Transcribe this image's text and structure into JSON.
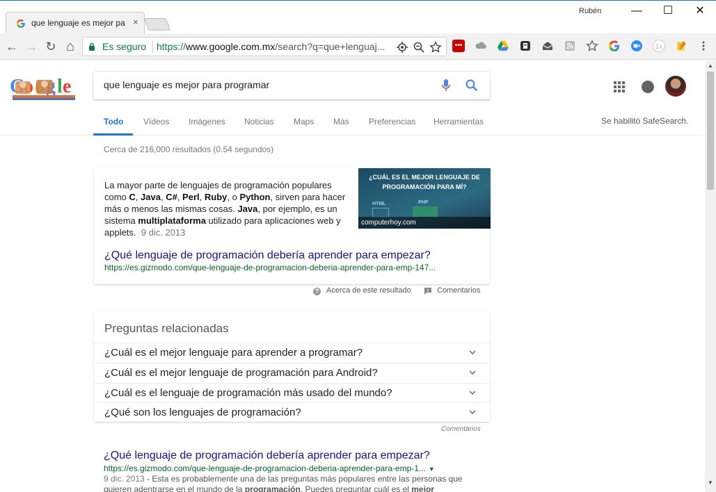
{
  "window": {
    "user_name": "Rubén",
    "minimize": "—",
    "maximize": "☐",
    "close": "✕"
  },
  "tab": {
    "title": "que lenguaje es mejor pa",
    "close": "×"
  },
  "toolbar": {
    "back": "←",
    "forward": "→",
    "reload": "↻",
    "home": "⌂",
    "secure_label": "Es seguro",
    "url_scheme": "https://",
    "url_host": "www.google.com.mx",
    "url_path": "/search?q=que+lenguaj...",
    "extensions": [
      "lastpass-icon",
      "cloud-icon",
      "drive-icon",
      "evernote-icon",
      "mail-icon",
      "rss-icon",
      "star-icon",
      "google-icon",
      "zoom-icon",
      "1x-icon",
      "notes-icon",
      "menu-icon"
    ],
    "ext_1x_label": "1x"
  },
  "google": {
    "search_query": "que lenguaje es mejor para programar",
    "tabs": [
      "Todo",
      "Vídeos",
      "Imágenes",
      "Noticias",
      "Maps",
      "Más",
      "Preferencias",
      "Herramientas"
    ],
    "safesearch": "Se habilitó SafeSearch."
  },
  "results": {
    "stats": "Cerca de 216,000 resultados (0.54 segundos)",
    "featured": {
      "text_parts": {
        "p1": "La mayor parte de lenguajes de programación populares como ",
        "c": "C",
        "comma1": ", ",
        "java": "Java",
        "comma2": ", ",
        "csharp": "C#",
        "comma3": ", ",
        "perl": "Perl",
        "comma4": ", ",
        "ruby": "Ruby",
        "o": ", o ",
        "python": "Python",
        "p2": ", sirven para hacer más o menos las mismas cosas. ",
        "java2": "Java",
        "p3": ", por ejemplo, es un sistema ",
        "multi": "multiplataforma",
        "p4": " utilizado para aplicaciones web y applets.",
        "date": "9 dic. 2013"
      },
      "image_title": "¿CUÁL ES EL MEJOR LENGUAJE DE PROGRAMACIÓN PARA MÍ?",
      "image_source": "computerhoy.com",
      "image_labels": [
        "HTML",
        "PHP"
      ],
      "link_title": "¿Qué lenguaje de programación debería aprender para empezar?",
      "link_url": "https://es.gizmodo.com/que-lenguaje-de-programacion-deberia-aprender-para-emp-147..."
    },
    "about_label": "Acerca de este resultado",
    "feedback_label": "Comentarios",
    "related": {
      "title": "Preguntas relacionadas",
      "questions": [
        "¿Cuál es el mejor lenguaje para aprender a programar?",
        "¿Cuál es el mejor lenguaje de programación para Android?",
        "¿Cuál es el lenguaje de programación más usado del mundo?",
        "¿Qué son los lenguajes de programación?"
      ],
      "feedback": "Comentarios"
    },
    "organic": {
      "title": "¿Qué lenguaje de programación debería aprender para empezar?",
      "url": "https://es.gizmodo.com/que-lenguaje-de-programacion-deberia-aprender-para-emp-1...",
      "snippet_date": "9 dic. 2013",
      "snippet_p1": " - Esta es probablemente una de las preguntas más populares entre las personas que quieren adentrarse en el mundo de la ",
      "snippet_b1": "programación",
      "snippet_p2": ". Puedes preguntar cuál es el ",
      "snippet_b2": "mejor lenguaje"
    }
  },
  "colors": {
    "link": "#1a0dab",
    "url": "#006621",
    "accent": "#1a73e8",
    "secure": "#0b8043"
  }
}
